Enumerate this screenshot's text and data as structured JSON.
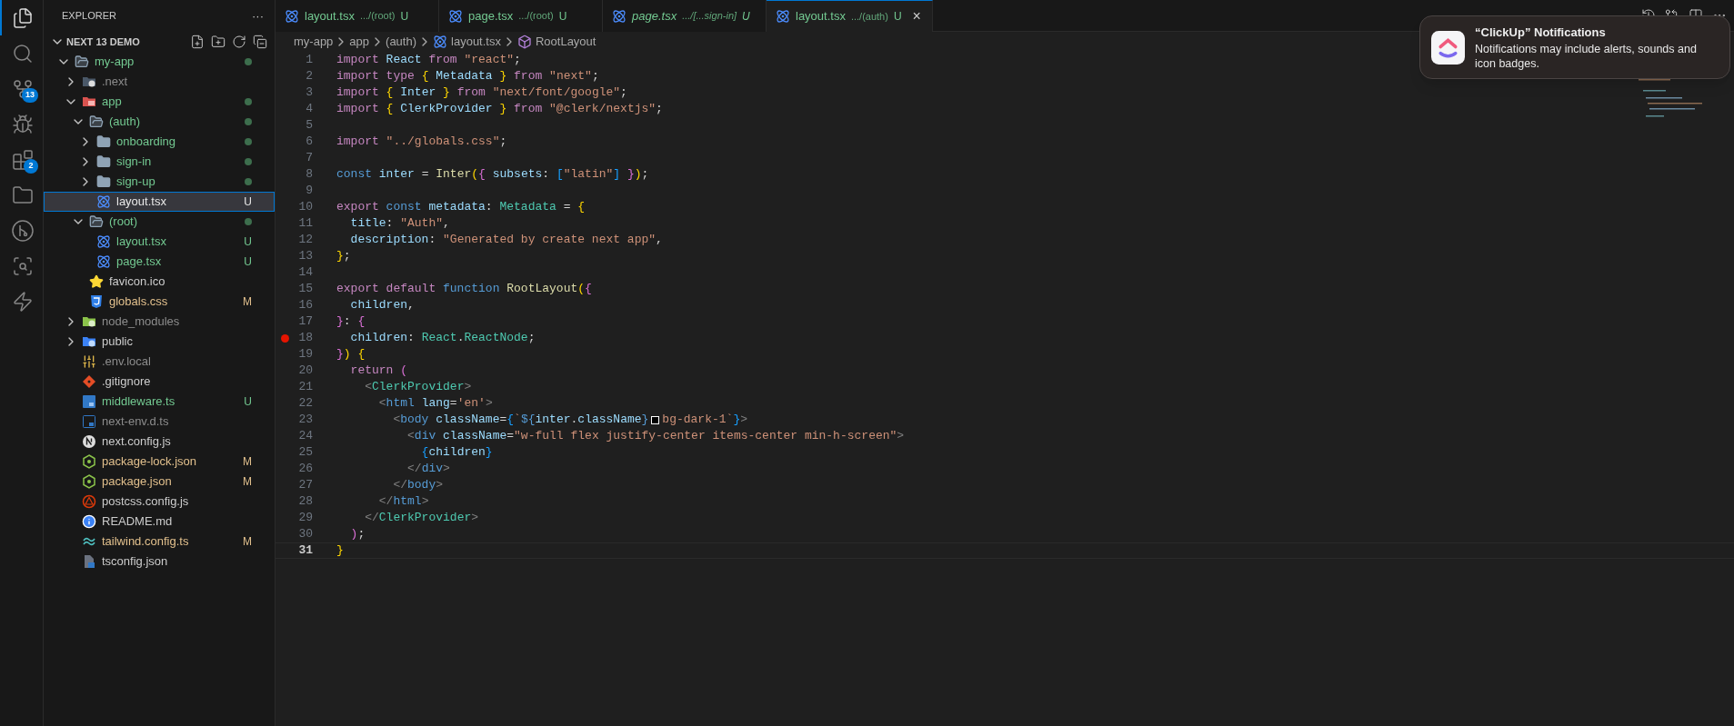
{
  "activity_bar": [
    {
      "kind": "files",
      "selected": true
    },
    {
      "kind": "search",
      "selected": false
    },
    {
      "kind": "source-control",
      "selected": false,
      "badge": "13"
    },
    {
      "kind": "run-debug",
      "selected": false
    },
    {
      "kind": "extensions",
      "selected": false,
      "badge": "2"
    },
    {
      "kind": "folders",
      "selected": false
    },
    {
      "kind": "git-graph",
      "selected": false
    },
    {
      "kind": "git-search",
      "selected": false
    },
    {
      "kind": "lightning",
      "selected": false
    }
  ],
  "sidebar": {
    "title": "EXPLORER",
    "more": "···",
    "section": {
      "title": "NEXT 13 DEMO",
      "expanded": true
    },
    "tree": [
      {
        "name": "my-app",
        "kind": "folder",
        "color": "#73c991",
        "dot": true,
        "expanded": true,
        "selected": false,
        "children": [
          {
            "name": ".next",
            "kind": "next-folder",
            "color": "#8c8c8c",
            "dot": false,
            "expanded": false,
            "selected": false
          },
          {
            "name": "app",
            "kind": "app-folder",
            "color": "#73c991",
            "dot": true,
            "expanded": true,
            "selected": false,
            "children": [
              {
                "name": "(auth)",
                "kind": "folder",
                "color": "#73c991",
                "dot": true,
                "expanded": true,
                "selected": false,
                "children": [
                  {
                    "name": "onboarding",
                    "kind": "folder",
                    "color": "#73c991",
                    "dot": true,
                    "expanded": false,
                    "selected": false
                  },
                  {
                    "name": "sign-in",
                    "kind": "folder",
                    "color": "#73c991",
                    "dot": true,
                    "expanded": false,
                    "selected": false
                  },
                  {
                    "name": "sign-up",
                    "kind": "folder",
                    "color": "#73c991",
                    "dot": true,
                    "expanded": false,
                    "selected": false
                  },
                  {
                    "name": "layout.tsx",
                    "kind": "react",
                    "status": "U",
                    "dot": false,
                    "selected": true
                  }
                ]
              },
              {
                "name": "(root)",
                "kind": "folder",
                "color": "#73c991",
                "dot": true,
                "expanded": true,
                "selected": false,
                "children": [
                  {
                    "name": "layout.tsx",
                    "kind": "react",
                    "color": "#73c991",
                    "status": "U",
                    "dot": false,
                    "selected": false
                  },
                  {
                    "name": "page.tsx",
                    "kind": "react",
                    "color": "#73c991",
                    "status": "U",
                    "dot": false,
                    "selected": false
                  }
                ]
              },
              {
                "name": "favicon.ico",
                "kind": "star",
                "color": "#cccccc",
                "dot": false,
                "selected": false
              },
              {
                "name": "globals.css",
                "kind": "css",
                "color": "#e2c08d",
                "status": "M",
                "dot": false,
                "selected": false
              }
            ]
          },
          {
            "name": "node_modules",
            "kind": "node-folder",
            "color": "#8c8c8c",
            "dot": false,
            "expanded": false,
            "selected": false
          },
          {
            "name": "public",
            "kind": "public-folder",
            "color": "#cccccc",
            "dot": false,
            "expanded": false,
            "selected": false
          },
          {
            "name": ".env.local",
            "kind": "env",
            "color": "#8c8c8c",
            "dot": false,
            "selected": false
          },
          {
            "name": ".gitignore",
            "kind": "git",
            "color": "#cccccc",
            "dot": false,
            "selected": false
          },
          {
            "name": "middleware.ts",
            "kind": "ts",
            "color": "#73c991",
            "status": "U",
            "dot": false,
            "selected": false
          },
          {
            "name": "next-env.d.ts",
            "kind": "ts-outline",
            "color": "#8c8c8c",
            "dot": false,
            "selected": false
          },
          {
            "name": "next.config.js",
            "kind": "next",
            "color": "#cccccc",
            "dot": false,
            "selected": false
          },
          {
            "name": "package-lock.json",
            "kind": "json",
            "color": "#e2c08d",
            "status": "M",
            "dot": false,
            "selected": false
          },
          {
            "name": "package.json",
            "kind": "json",
            "color": "#e2c08d",
            "status": "M",
            "dot": false,
            "selected": false
          },
          {
            "name": "postcss.config.js",
            "kind": "postcss",
            "color": "#cccccc",
            "dot": false,
            "selected": false
          },
          {
            "name": "README.md",
            "kind": "info",
            "color": "#cccccc",
            "dot": false,
            "selected": false
          },
          {
            "name": "tailwind.config.ts",
            "kind": "tailwind",
            "color": "#e2c08d",
            "status": "M",
            "dot": false,
            "selected": false
          },
          {
            "name": "tsconfig.json",
            "kind": "tsconfig",
            "color": "#cccccc",
            "dot": false,
            "selected": false
          }
        ]
      }
    ]
  },
  "tabs": [
    {
      "label": "layout.tsx",
      "description": ".../(root)",
      "status": "U",
      "selected": false,
      "preview": false
    },
    {
      "label": "page.tsx",
      "description": ".../(root)",
      "status": "U",
      "selected": false,
      "preview": false
    },
    {
      "label": "page.tsx",
      "description": ".../[...sign-in]",
      "status": "U",
      "selected": false,
      "preview": true
    },
    {
      "label": "layout.tsx",
      "description": ".../(auth)",
      "status": "U",
      "selected": true,
      "preview": false,
      "close": "×"
    }
  ],
  "breadcrumbs": [
    {
      "label": "my-app",
      "kind": "folder"
    },
    {
      "label": "app",
      "kind": "folder"
    },
    {
      "label": "(auth)",
      "kind": "folder"
    },
    {
      "label": "layout.tsx",
      "kind": "file"
    },
    {
      "label": "RootLayout",
      "kind": "symbol"
    }
  ],
  "code": {
    "lines": [
      {
        "number": "1",
        "breakpoint": false,
        "current": false,
        "tokens": [
          {
            "text": "import",
            "kind": "kw"
          },
          {
            "text": " React",
            "kind": "var"
          },
          {
            "text": " from",
            "kind": "kw"
          },
          {
            "text": " \"react\"",
            "kind": "str"
          },
          {
            "text": ";",
            "kind": "p"
          }
        ]
      },
      {
        "number": "2",
        "breakpoint": false,
        "current": false,
        "tokens": [
          {
            "text": "import type",
            "kind": "kw"
          },
          {
            "text": " {",
            "kind": "b1"
          },
          {
            "text": " Metadata",
            "kind": "var"
          },
          {
            "text": " }",
            "kind": "b1"
          },
          {
            "text": " from",
            "kind": "kw"
          },
          {
            "text": " \"next\"",
            "kind": "str"
          },
          {
            "text": ";",
            "kind": "p"
          }
        ]
      },
      {
        "number": "3",
        "breakpoint": false,
        "current": false,
        "tokens": [
          {
            "text": "import",
            "kind": "kw"
          },
          {
            "text": " {",
            "kind": "b1"
          },
          {
            "text": " Inter",
            "kind": "var"
          },
          {
            "text": " }",
            "kind": "b1"
          },
          {
            "text": " from",
            "kind": "kw"
          },
          {
            "text": " \"next/font/google\"",
            "kind": "str"
          },
          {
            "text": ";",
            "kind": "p"
          }
        ]
      },
      {
        "number": "4",
        "breakpoint": false,
        "current": false,
        "tokens": [
          {
            "text": "import",
            "kind": "kw"
          },
          {
            "text": " {",
            "kind": "b1"
          },
          {
            "text": " ClerkProvider",
            "kind": "var"
          },
          {
            "text": " }",
            "kind": "b1"
          },
          {
            "text": " from",
            "kind": "kw"
          },
          {
            "text": " \"@clerk/nextjs\"",
            "kind": "str"
          },
          {
            "text": ";",
            "kind": "p"
          }
        ]
      },
      {
        "number": "5",
        "breakpoint": false,
        "current": false
      },
      {
        "number": "6",
        "breakpoint": false,
        "current": false,
        "tokens": [
          {
            "text": "import",
            "kind": "kw"
          },
          {
            "text": " \"../globals.css\"",
            "kind": "str"
          },
          {
            "text": ";",
            "kind": "p"
          }
        ]
      },
      {
        "number": "7",
        "breakpoint": false,
        "current": false
      },
      {
        "number": "8",
        "breakpoint": false,
        "current": false,
        "tokens": [
          {
            "text": "const",
            "kind": "st"
          },
          {
            "text": " inter",
            "kind": "var"
          },
          {
            "text": " = ",
            "kind": "p"
          },
          {
            "text": "Inter",
            "kind": "fn"
          },
          {
            "text": "(",
            "kind": "b1"
          },
          {
            "text": "{",
            "kind": "b2"
          },
          {
            "text": " subsets",
            "kind": "var"
          },
          {
            "text": ": ",
            "kind": "p"
          },
          {
            "text": "[",
            "kind": "b3"
          },
          {
            "text": "\"latin\"",
            "kind": "str"
          },
          {
            "text": "]",
            "kind": "b3"
          },
          {
            "text": " }",
            "kind": "b2"
          },
          {
            "text": ")",
            "kind": "b1"
          },
          {
            "text": ";",
            "kind": "p"
          }
        ]
      },
      {
        "number": "9",
        "breakpoint": false,
        "current": false
      },
      {
        "number": "10",
        "breakpoint": false,
        "current": false,
        "tokens": [
          {
            "text": "export",
            "kind": "kw"
          },
          {
            "text": " const",
            "kind": "st"
          },
          {
            "text": " metadata",
            "kind": "var"
          },
          {
            "text": ": ",
            "kind": "p"
          },
          {
            "text": "Metadata",
            "kind": "type"
          },
          {
            "text": " = ",
            "kind": "p"
          },
          {
            "text": "{",
            "kind": "b1"
          }
        ]
      },
      {
        "number": "11",
        "breakpoint": false,
        "current": false,
        "tokens": [
          {
            "text": "  title",
            "kind": "var"
          },
          {
            "text": ": ",
            "kind": "p"
          },
          {
            "text": "\"Auth\"",
            "kind": "str"
          },
          {
            "text": ",",
            "kind": "p"
          }
        ]
      },
      {
        "number": "12",
        "breakpoint": false,
        "current": false,
        "tokens": [
          {
            "text": "  description",
            "kind": "var"
          },
          {
            "text": ": ",
            "kind": "p"
          },
          {
            "text": "\"Generated by create next app\"",
            "kind": "str"
          },
          {
            "text": ",",
            "kind": "p"
          }
        ]
      },
      {
        "number": "13",
        "breakpoint": false,
        "current": false,
        "tokens": [
          {
            "text": "}",
            "kind": "b1"
          },
          {
            "text": ";",
            "kind": "p"
          }
        ]
      },
      {
        "number": "14",
        "breakpoint": false,
        "current": false
      },
      {
        "number": "15",
        "breakpoint": false,
        "current": false,
        "tokens": [
          {
            "text": "export default",
            "kind": "kw"
          },
          {
            "text": " function",
            "kind": "st"
          },
          {
            "text": " RootLayout",
            "kind": "fn"
          },
          {
            "text": "(",
            "kind": "b1"
          },
          {
            "text": "{",
            "kind": "b2"
          }
        ]
      },
      {
        "number": "16",
        "breakpoint": false,
        "current": false,
        "tokens": [
          {
            "text": "  children",
            "kind": "var"
          },
          {
            "text": ",",
            "kind": "p"
          }
        ]
      },
      {
        "number": "17",
        "breakpoint": false,
        "current": false,
        "tokens": [
          {
            "text": "}",
            "kind": "b2"
          },
          {
            "text": ": ",
            "kind": "p"
          },
          {
            "text": "{",
            "kind": "b2"
          }
        ]
      },
      {
        "number": "18",
        "breakpoint": true,
        "current": false,
        "tokens": [
          {
            "text": "  children",
            "kind": "var"
          },
          {
            "text": ": ",
            "kind": "p"
          },
          {
            "text": "React",
            "kind": "type"
          },
          {
            "text": ".",
            "kind": "p"
          },
          {
            "text": "ReactNode",
            "kind": "type"
          },
          {
            "text": ";",
            "kind": "p"
          }
        ]
      },
      {
        "number": "19",
        "breakpoint": false,
        "current": false,
        "tokens": [
          {
            "text": "}",
            "kind": "b2"
          },
          {
            "text": ")",
            "kind": "b1"
          },
          {
            "text": " {",
            "kind": "b1"
          }
        ]
      },
      {
        "number": "20",
        "breakpoint": false,
        "current": false,
        "tokens": [
          {
            "text": "  return",
            "kind": "kw"
          },
          {
            "text": " (",
            "kind": "b2"
          }
        ]
      },
      {
        "number": "21",
        "breakpoint": false,
        "current": false,
        "tokens": [
          {
            "text": "    <",
            "kind": "tag"
          },
          {
            "text": "ClerkProvider",
            "kind": "type"
          },
          {
            "text": ">",
            "kind": "tag"
          }
        ]
      },
      {
        "number": "22",
        "breakpoint": false,
        "current": false,
        "tokens": [
          {
            "text": "      <",
            "kind": "tag"
          },
          {
            "text": "html",
            "kind": "st"
          },
          {
            "text": " lang",
            "kind": "var"
          },
          {
            "text": "=",
            "kind": "p"
          },
          {
            "text": "'en'",
            "kind": "str"
          },
          {
            "text": ">",
            "kind": "tag"
          }
        ]
      },
      {
        "number": "23",
        "breakpoint": false,
        "current": false,
        "tokens": [
          {
            "text": "        <",
            "kind": "tag"
          },
          {
            "text": "body",
            "kind": "st"
          },
          {
            "text": " className",
            "kind": "var"
          },
          {
            "text": "=",
            "kind": "p"
          },
          {
            "text": "{",
            "kind": "b3"
          },
          {
            "text": "`",
            "kind": "str"
          },
          {
            "text": "${",
            "kind": "st"
          },
          {
            "text": "inter",
            "kind": "var"
          },
          {
            "text": ".",
            "kind": "p"
          },
          {
            "text": "className",
            "kind": "var"
          },
          {
            "text": "}",
            "kind": "st"
          },
          {
            "kind": "swatch",
            "color": "#000000"
          },
          {
            "text": "bg-dark-1`",
            "kind": "str"
          },
          {
            "text": "}",
            "kind": "b3"
          },
          {
            "text": ">",
            "kind": "tag"
          }
        ]
      },
      {
        "number": "24",
        "breakpoint": false,
        "current": false,
        "tokens": [
          {
            "text": "          <",
            "kind": "tag"
          },
          {
            "text": "div",
            "kind": "st"
          },
          {
            "text": " className",
            "kind": "var"
          },
          {
            "text": "=",
            "kind": "p"
          },
          {
            "text": "\"w-full flex justify-center items-center min-h-screen\"",
            "kind": "str"
          },
          {
            "text": ">",
            "kind": "tag"
          }
        ]
      },
      {
        "number": "25",
        "breakpoint": false,
        "current": false,
        "tokens": [
          {
            "text": "            {",
            "kind": "b3"
          },
          {
            "text": "children",
            "kind": "var"
          },
          {
            "text": "}",
            "kind": "b3"
          }
        ]
      },
      {
        "number": "26",
        "breakpoint": false,
        "current": false,
        "tokens": [
          {
            "text": "          </",
            "kind": "tag"
          },
          {
            "text": "div",
            "kind": "st"
          },
          {
            "text": ">",
            "kind": "tag"
          }
        ]
      },
      {
        "number": "27",
        "breakpoint": false,
        "current": false,
        "tokens": [
          {
            "text": "        </",
            "kind": "tag"
          },
          {
            "text": "body",
            "kind": "st"
          },
          {
            "text": ">",
            "kind": "tag"
          }
        ]
      },
      {
        "number": "28",
        "breakpoint": false,
        "current": false,
        "tokens": [
          {
            "text": "      </",
            "kind": "tag"
          },
          {
            "text": "html",
            "kind": "st"
          },
          {
            "text": ">",
            "kind": "tag"
          }
        ]
      },
      {
        "number": "29",
        "breakpoint": false,
        "current": false,
        "tokens": [
          {
            "text": "    </",
            "kind": "tag"
          },
          {
            "text": "ClerkProvider",
            "kind": "type"
          },
          {
            "text": ">",
            "kind": "tag"
          }
        ]
      },
      {
        "number": "30",
        "breakpoint": false,
        "current": false,
        "tokens": [
          {
            "text": "  )",
            "kind": "b2"
          },
          {
            "text": ";",
            "kind": "p"
          }
        ]
      },
      {
        "number": "31",
        "breakpoint": false,
        "current": true,
        "tokens": [
          {
            "text": "}",
            "kind": "b1"
          }
        ]
      }
    ]
  },
  "notification": {
    "title": "“ClickUp” Notifications",
    "body": "Notifications may include alerts, sounds and icon badges."
  }
}
